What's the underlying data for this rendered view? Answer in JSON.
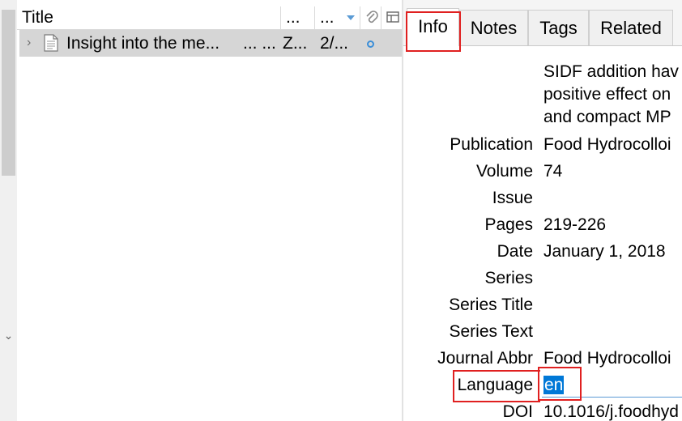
{
  "items_pane": {
    "columns": {
      "title": "Title",
      "creator": "...",
      "date": "...",
      "attachments_icon": "paperclip-icon",
      "extra_icon": "column-picker-icon"
    },
    "rows": [
      {
        "title": "Insight into the me...",
        "creator": "... ...",
        "item_type": "Z...",
        "date": "2/...",
        "icon": "document-icon"
      }
    ]
  },
  "tabs": {
    "info": "Info",
    "notes": "Notes",
    "tags": "Tags",
    "related": "Related"
  },
  "abstract_lines": [
    "SIDF addition hav",
    "positive effect on",
    "and compact MP"
  ],
  "fields": [
    {
      "label": "Publication",
      "value": "Food Hydrocolloi"
    },
    {
      "label": "Volume",
      "value": "74"
    },
    {
      "label": "Issue",
      "value": ""
    },
    {
      "label": "Pages",
      "value": "219-226"
    },
    {
      "label": "Date",
      "value": "January 1, 2018"
    },
    {
      "label": "Series",
      "value": ""
    },
    {
      "label": "Series Title",
      "value": ""
    },
    {
      "label": "Series Text",
      "value": ""
    },
    {
      "label": "Journal Abbr",
      "value": "Food Hydrocolloi"
    },
    {
      "label": "Language",
      "value": "en"
    },
    {
      "label": "DOI",
      "value": "10.1016/j.foodhyd"
    }
  ],
  "colors": {
    "highlight_box": "#e02020",
    "selection": "#0078d7",
    "row_selected": "#d6d6d6"
  }
}
